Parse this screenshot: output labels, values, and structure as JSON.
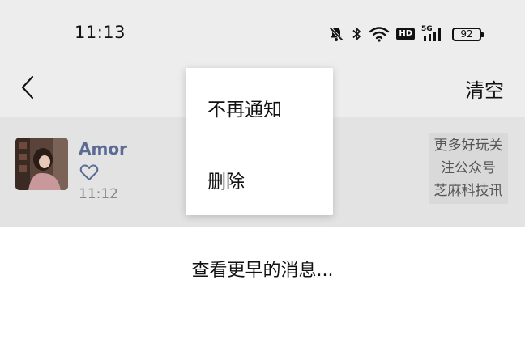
{
  "status_bar": {
    "time": "11:13",
    "network_badge": "HD",
    "cellular_label": "5G",
    "battery_level": "92",
    "icons": [
      "bell-off-icon",
      "bluetooth-icon",
      "wifi-icon",
      "hd-icon",
      "cellular-icon",
      "battery-icon"
    ]
  },
  "nav": {
    "back_icon": "chevron-left-icon",
    "clear_label": "清空"
  },
  "message": {
    "sender": "Amor",
    "reaction_icon": "heart-outline-icon",
    "time": "11:12",
    "preview_lines": [
      "更多好玩关",
      "注公众号",
      "芝麻科技讯"
    ]
  },
  "more_label": "查看更早的消息...",
  "context_menu": {
    "items": [
      "不再通知",
      "删除"
    ]
  },
  "colors": {
    "sender_name": "#5b6b94",
    "background": "#ededed",
    "row_background": "#e3e3e3"
  }
}
